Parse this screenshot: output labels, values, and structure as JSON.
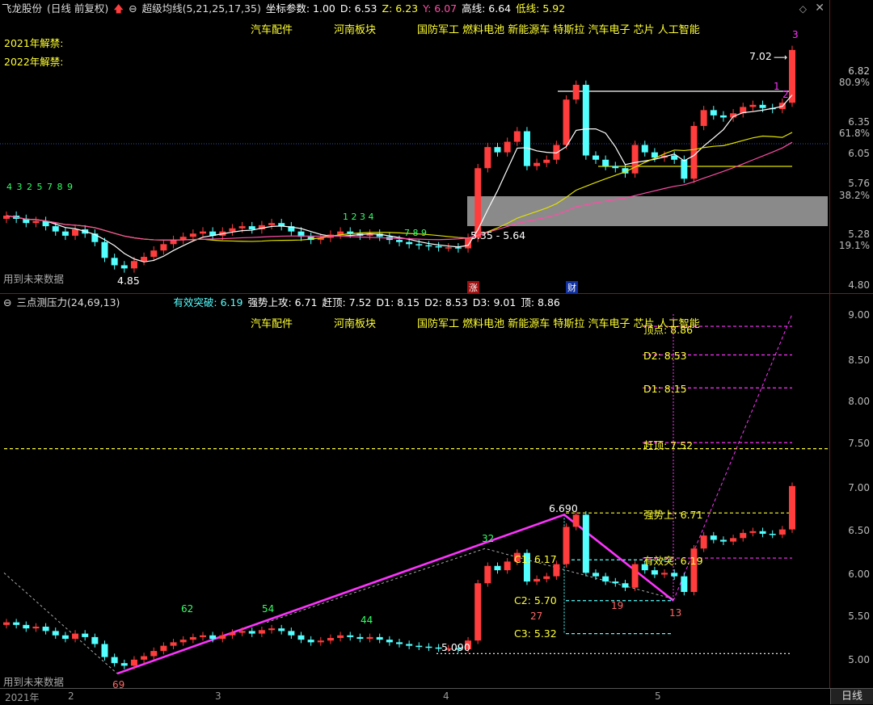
{
  "top": {
    "stock_name": "飞龙股份",
    "period_mode": "(日线 前复权)",
    "indicator": "超级均线(5,21,25,17,35)",
    "coord_label": "坐标参数: 1.00",
    "d_label": "D: 6.53",
    "z_label": "Z: 6.23",
    "y_label": "Y: 6.07",
    "high_label": "高线: 6.64",
    "low_label": "低线: 5.92",
    "concepts": [
      "汽车配件",
      "河南板块",
      "国防军工 燃料电池 新能源车 特斯拉 汽车电子 芯片 人工智能"
    ],
    "unlock_2021": "2021年解禁:",
    "unlock_2022": "2022年解禁:",
    "future_note": "用到未来数据",
    "y_axis": [
      "6.82",
      "80.9%",
      "6.35",
      "61.8%",
      "6.05",
      "5.76",
      "38.2%",
      "5.28",
      "19.1%",
      "4.80"
    ],
    "annot_high": "7.02",
    "annot_low": "4.85",
    "annot_range": "5.35 - 5.64",
    "tag_rise": "涨",
    "tag_fin": "财",
    "tag_3": "3",
    "tag_1": "1",
    "tag_2": "2",
    "seq_left": "4  3  2  5  7  8  9",
    "seq_mid": "1  2  3  4",
    "seq_mid2": "7 8 9"
  },
  "bottom": {
    "indicator": "三点测压力(24,69,13)",
    "valid_break": "有效突破: 6.19",
    "strong_attack": "强势上攻: 6.71",
    "top_catch": "赶顶: 7.52",
    "d1": "D1: 8.15",
    "d2": "D2: 8.53",
    "d3": "D3: 9.01",
    "peak": "顶: 8.86",
    "concepts": [
      "汽车配件",
      "河南板块",
      "国防军工 燃料电池 新能源车 特斯拉 汽车电子 芯片 人工智能"
    ],
    "future_note": "用到未来数据",
    "y_axis": [
      "9.00",
      "8.50",
      "8.00",
      "7.50",
      "7.00",
      "6.50",
      "6.00",
      "5.50",
      "5.00"
    ],
    "lbl_peak": "顶点: 8.86",
    "lbl_d2": "D2: 8.53",
    "lbl_d1": "D1: 8.15",
    "lbl_top": "赶顶: 7.52",
    "lbl_strong": "强势上: 6.71",
    "lbl_valid": "有效突: 6.19",
    "lbl_c1": "C1: 6.17",
    "lbl_c2": "C2: 5.70",
    "lbl_c3": "C3: 5.32",
    "lbl_6690": "6.690",
    "lbl_5090": "5.090",
    "num_32": "32",
    "num_62": "62",
    "num_54": "54",
    "num_44": "44",
    "num_69": "69",
    "num_27": "27",
    "num_19": "19",
    "num_13": "13"
  },
  "timeline": {
    "year": "2021年",
    "m2": "2",
    "m3": "3",
    "m4": "4",
    "m5": "5",
    "period_button": "日线"
  },
  "colors": {
    "up": "#ff3d3d",
    "down": "#54ffff",
    "ma_white": "#ffffff",
    "ma_yellow": "#e0e000",
    "ma_pink": "#ff4da6",
    "zigzag": "#ff33ff"
  }
}
